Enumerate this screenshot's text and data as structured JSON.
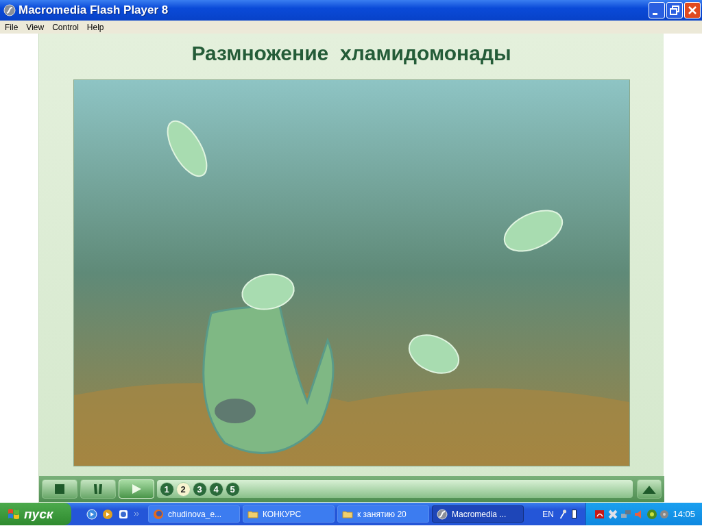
{
  "window": {
    "title": "Macromedia Flash Player 8"
  },
  "menu": [
    "File",
    "View",
    "Control",
    "Help"
  ],
  "slide": {
    "title": "Размножение  хламидомонады"
  },
  "controls": [
    {
      "kind": "stop",
      "selected": false
    },
    {
      "kind": "pause",
      "selected": false
    },
    {
      "kind": "play",
      "selected": true
    }
  ],
  "pages": [
    {
      "label": "1",
      "selected": false
    },
    {
      "label": "2",
      "selected": true
    },
    {
      "label": "3",
      "selected": false
    },
    {
      "label": "4",
      "selected": false
    },
    {
      "label": "5",
      "selected": false
    }
  ],
  "taskbar": {
    "start": "пуск",
    "tasks": [
      {
        "label": "chudinova_e...",
        "kind": "browser",
        "selected": false
      },
      {
        "label": "КОНКУРС",
        "kind": "folder",
        "selected": false
      },
      {
        "label": "к занятию 20",
        "kind": "folder",
        "selected": false
      },
      {
        "label": "Macromedia ...",
        "kind": "flash",
        "selected": true
      }
    ],
    "language": "EN",
    "clock": "14:05"
  }
}
